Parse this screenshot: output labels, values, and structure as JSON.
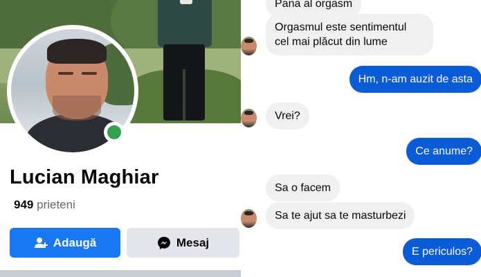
{
  "profile": {
    "name": "Lucian Maghiar",
    "friends_count": "949",
    "friends_label": "prieteni",
    "add_button": "Adaugă",
    "message_button": "Mesaj",
    "online_status_color": "#31a24c"
  },
  "chat": {
    "messages": [
      {
        "side": "received",
        "text": "Pana al orgasm"
      },
      {
        "side": "received",
        "text": "Orgasmul este sentimentul"
      },
      {
        "side": "received",
        "text": "cel mai plăcut din lume"
      },
      {
        "side": "sent",
        "text": "Hm, n-am auzit de asta"
      },
      {
        "side": "received",
        "text": "Vrei?"
      },
      {
        "side": "sent",
        "text": "Ce anume?"
      },
      {
        "side": "received",
        "text": "Sa o facem"
      },
      {
        "side": "received",
        "text": "Sa te ajut sa te masturbezi"
      },
      {
        "side": "sent",
        "text": "E periculos?"
      }
    ]
  },
  "colors": {
    "accent": "#1877f2",
    "sent_bubble": "#0a5bd8",
    "received_bubble": "#f0f0f0"
  },
  "icons": [
    "add-friend-icon",
    "messenger-icon"
  ]
}
